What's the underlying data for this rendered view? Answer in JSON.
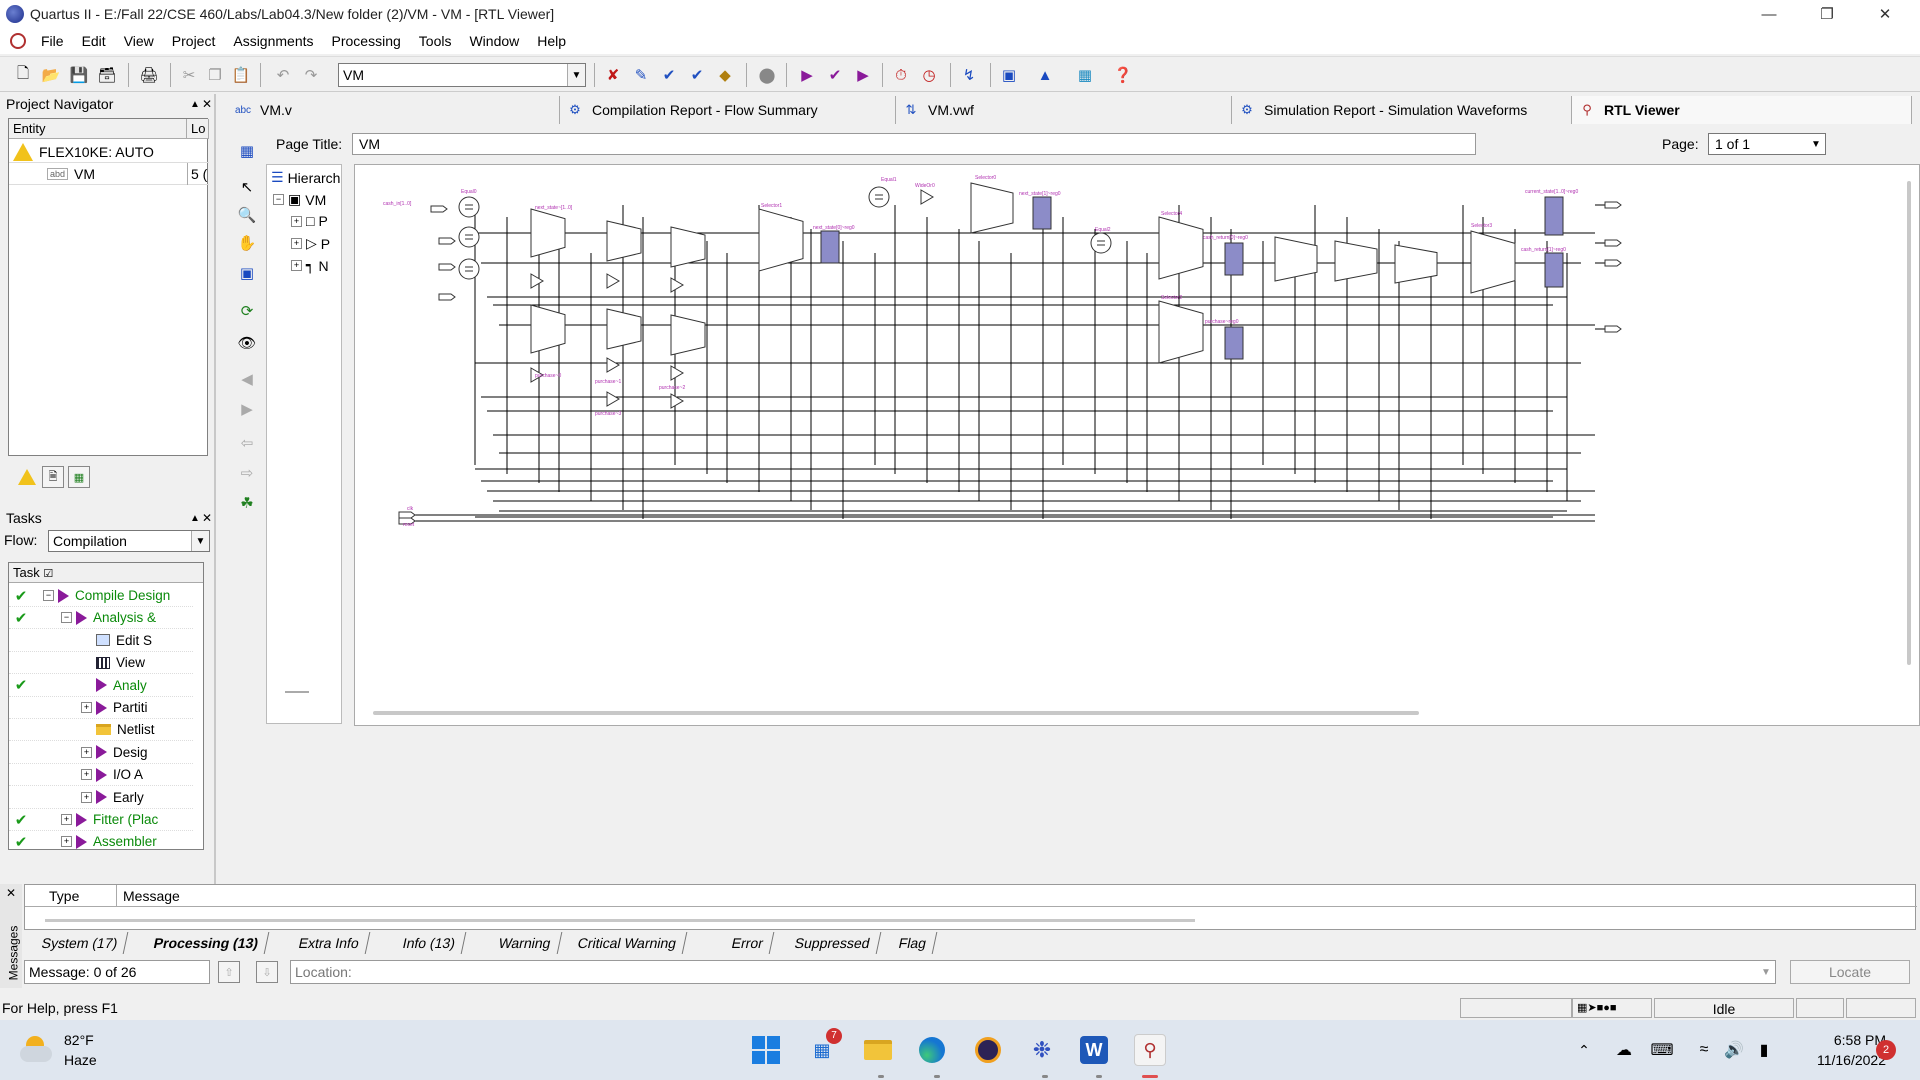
{
  "window": {
    "title": "Quartus II - E:/Fall 22/CSE 460/Labs/Lab04.3/New folder (2)/VM - VM - [RTL Viewer]",
    "controls": [
      "minimize",
      "restore",
      "close"
    ]
  },
  "menubar": {
    "items": [
      "File",
      "Edit",
      "View",
      "Project",
      "Assignments",
      "Processing",
      "Tools",
      "Window",
      "Help"
    ]
  },
  "toolbar": {
    "entity_combo_value": "VM"
  },
  "project_navigator": {
    "title": "Project Navigator",
    "columns": [
      "Entity",
      "Lo"
    ],
    "rows": [
      {
        "name": "FLEX10KE: AUTO",
        "lo": "",
        "icon": "warning-icon"
      },
      {
        "name": "VM",
        "lo": "5 (",
        "icon": "abd-file-icon"
      }
    ]
  },
  "tasks": {
    "title": "Tasks",
    "flow_label": "Flow:",
    "flow_value": "Compilation",
    "column": "Task",
    "items": [
      {
        "label": "Compile Design",
        "done": true,
        "level": 0,
        "color": "#0a8a0a"
      },
      {
        "label": "Analysis &",
        "done": true,
        "level": 1,
        "color": "#0a8a0a"
      },
      {
        "label": "Edit S",
        "done": false,
        "level": 2,
        "color": "#000"
      },
      {
        "label": "View",
        "done": false,
        "level": 2,
        "color": "#000"
      },
      {
        "label": "Analy",
        "done": true,
        "level": 2,
        "color": "#0a8a0a"
      },
      {
        "label": "Partiti",
        "done": false,
        "level": 2,
        "color": "#000"
      },
      {
        "label": "Netlist",
        "done": false,
        "level": 2,
        "color": "#000"
      },
      {
        "label": "Desig",
        "done": false,
        "level": 2,
        "color": "#000"
      },
      {
        "label": "I/O A",
        "done": false,
        "level": 2,
        "color": "#000"
      },
      {
        "label": "Early",
        "done": false,
        "level": 2,
        "color": "#000"
      },
      {
        "label": "Fitter (Plac",
        "done": true,
        "level": 1,
        "color": "#0a8a0a"
      },
      {
        "label": "Assembler",
        "done": true,
        "level": 1,
        "color": "#0a8a0a"
      }
    ]
  },
  "doc_tabs": [
    {
      "label": "VM.v",
      "icon": "verilog-file-icon"
    },
    {
      "label": "Compilation Report - Flow Summary",
      "icon": "report-icon"
    },
    {
      "label": "VM.vwf",
      "icon": "waveform-icon"
    },
    {
      "label": "Simulation Report - Simulation Waveforms",
      "icon": "report-icon"
    },
    {
      "label": "RTL Viewer",
      "icon": "rtl-viewer-icon",
      "active": true
    }
  ],
  "rtl_viewer": {
    "page_title_label": "Page Title:",
    "page_title_value": "VM",
    "page_label": "Page:",
    "page_value": "1 of 1",
    "hierarchy": {
      "title": "Hierarch",
      "root": "VM",
      "children": [
        "P",
        "P",
        "N"
      ]
    }
  },
  "messages": {
    "columns": [
      "Type",
      "Message"
    ],
    "tabs": [
      "System (17)",
      "Processing (13)",
      "Extra Info",
      "Info (13)",
      "Warning",
      "Critical Warning",
      "Error",
      "Suppressed",
      "Flag"
    ],
    "active_tab": "Processing (13)",
    "counter": "Message: 0 of 26",
    "location_placeholder": "Location:",
    "locate_button": "Locate",
    "side_label": "Messages"
  },
  "statusbar": {
    "help": "For Help, press F1",
    "state": "Idle"
  },
  "taskbar": {
    "weather_temp": "82°F",
    "weather_desc": "Haze",
    "time": "6:58 PM",
    "date": "11/16/2022",
    "notif_count": "2",
    "store_badge": "7"
  }
}
